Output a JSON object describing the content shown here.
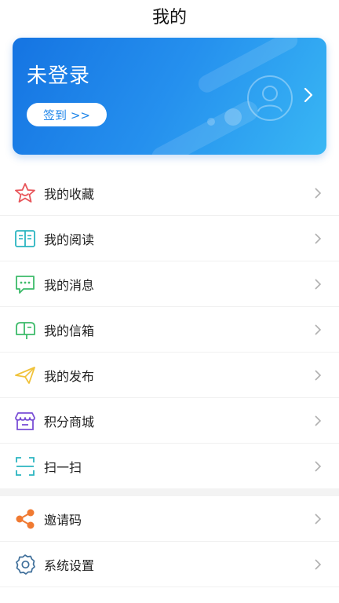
{
  "header": {
    "title": "我的"
  },
  "profile": {
    "status": "未登录",
    "checkin_label": "签到 >>",
    "colors": {
      "card_start": "#1574e2",
      "card_end": "#39b7f4"
    }
  },
  "menu": {
    "group1": [
      {
        "label": "我的收藏",
        "icon": "star-icon"
      },
      {
        "label": "我的阅读",
        "icon": "book-icon"
      },
      {
        "label": "我的消息",
        "icon": "message-icon"
      },
      {
        "label": "我的信箱",
        "icon": "mailbox-icon"
      },
      {
        "label": "我的发布",
        "icon": "paper-plane-icon"
      },
      {
        "label": "积分商城",
        "icon": "store-icon"
      },
      {
        "label": "扫一扫",
        "icon": "scan-icon"
      }
    ],
    "group2": [
      {
        "label": "邀请码",
        "icon": "share-icon"
      },
      {
        "label": "系统设置",
        "icon": "gear-icon"
      }
    ]
  }
}
